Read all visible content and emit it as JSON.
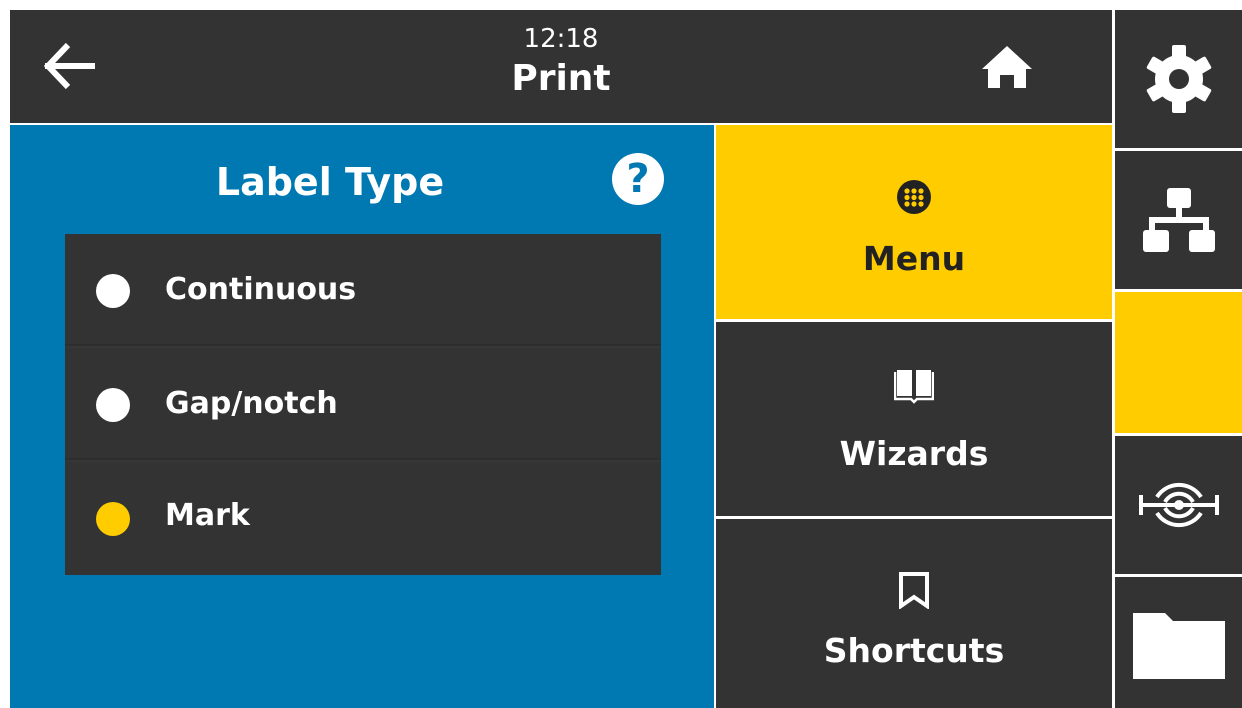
{
  "header": {
    "time": "12:18",
    "title": "Print",
    "back_icon": "back-arrow-icon",
    "home_icon": "home-icon"
  },
  "panel": {
    "title": "Label Type",
    "help_icon": "help-icon",
    "help_glyph": "?",
    "options": [
      {
        "label": "Continuous",
        "selected": false
      },
      {
        "label": "Gap/notch",
        "selected": false
      },
      {
        "label": "Mark",
        "selected": true
      }
    ]
  },
  "nav": {
    "menu_label": "Menu",
    "wizards_label": "Wizards",
    "shortcuts_label": "Shortcuts",
    "active": "Menu"
  },
  "rail": {
    "icons": [
      "gear-icon",
      "network-icon",
      "status-icon",
      "rfid-icon",
      "folder-icon"
    ]
  },
  "colors": {
    "accent": "#ffcc00",
    "panel_blue": "#0079b3",
    "dark": "#333333",
    "white": "#ffffff"
  }
}
